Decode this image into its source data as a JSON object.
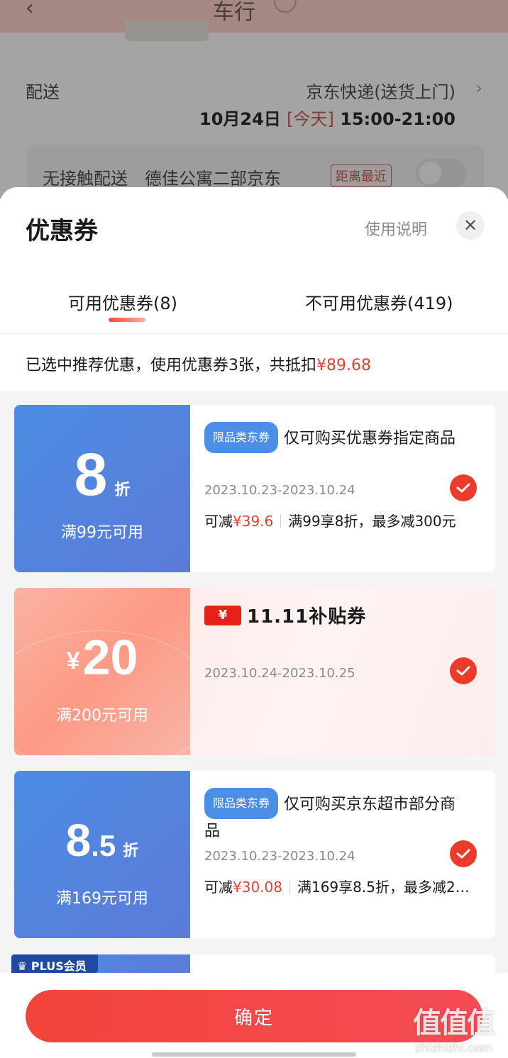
{
  "background": {
    "back_glyph": "‹",
    "title": "车行",
    "delivery_label": "配送",
    "delivery_method": "京东快递(送货上门)",
    "delivery_date": "10月24日",
    "delivery_today": "[今天]",
    "delivery_time": "15:00-21:00",
    "pickup_text": "无接触配送　德佳公寓二部京东",
    "pickup_badge": "距离最近"
  },
  "sheet": {
    "title": "优惠券",
    "help_link": "使用说明",
    "close_glyph": "✕",
    "tabs": [
      {
        "label": "可用优惠券(8)",
        "active": true
      },
      {
        "label": "不可用优惠券(419)",
        "active": false
      }
    ],
    "summary_prefix": "已选中推荐优惠，使用优惠券3张，共抵扣",
    "summary_amount": "¥89.68"
  },
  "coupons": [
    {
      "value": "8",
      "unit": "折",
      "condition": "满99元可用",
      "tag": "限品类东券",
      "description": "仅可购买优惠券指定商品",
      "date": "2023.10.23-2023.10.24",
      "save_label": "可减",
      "save_amount": "¥39.6",
      "rule": "满99享8折，最多减300元",
      "selected": true
    },
    {
      "value_prefix": "¥",
      "value": "20",
      "condition": "满200元可用",
      "logo_yen": "¥",
      "logo_text": "11.11补贴券",
      "date": "2023.10.24-2023.10.25",
      "selected": true
    },
    {
      "value_int": "8",
      "value_dec": ".5",
      "unit": "折",
      "condition": "满169元可用",
      "tag": "限品类东券",
      "description": "仅可购买京东超市部分商品",
      "date": "2023.10.23-2023.10.24",
      "save_label": "可减",
      "save_amount": "¥30.08",
      "rule": "满169享8.5折，最多减2…",
      "selected": true
    }
  ],
  "plus_badge": "PLUS会员",
  "confirm_button": "确定",
  "watermark": {
    "logo": "值值值",
    "url": "zhizhizhi.com"
  },
  "colors": {
    "accent": "#e8402f",
    "coupon_blue": "#4c8de4",
    "confirm": "#f3443b"
  }
}
